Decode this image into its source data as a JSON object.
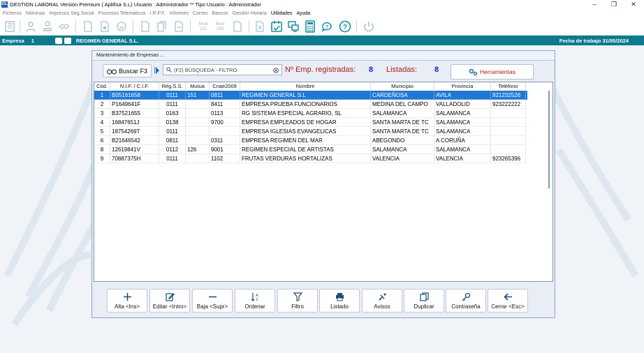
{
  "window": {
    "title": "GESTION LABORAL Versión Premium ( Aplifisa S.L)   Usuario : Administrador  **  Tipo Usuario : Administrador",
    "app_icon_text": "GL"
  },
  "menu": [
    "Ficheros",
    "Nóminas",
    "Impresos Seg.Social",
    "Procesos Telemáticos",
    "I.R.P.F.",
    "Informes",
    "Correo",
    "Bancos",
    "Gestión Horaria",
    "Utilidades",
    "Ayuda"
  ],
  "toolbar": {
    "mod111": "Mod\n111",
    "mod190": "Mod\n190"
  },
  "empresa_bar": {
    "label": "Empresa",
    "number": "1",
    "name": "REGIMEN GENERAL  S.L.",
    "fecha": "Fecha de trabajo  31/05/2024"
  },
  "dialog": {
    "title": "Mantenimiento de Empresas ...",
    "search_button": "Buscar F3",
    "search_placeholder": "(F2) BÚSQUEDA - FILTRO",
    "registradas_label": "Nº Emp. registradas:",
    "registradas_value": "8",
    "listadas_label": "Listadas:",
    "listadas_value": "8",
    "tools_button": "Herramientas"
  },
  "grid": {
    "columns": [
      "Cód.",
      "N.I.F. / C.I.F.",
      "Rég.S.S.",
      "Mutua",
      "Cnae2009",
      "Nombre",
      "Municipio",
      "Provincia",
      "Teléfono"
    ],
    "rows": [
      [
        "1",
        "B05161658",
        "0111",
        "151",
        "0811",
        "REGIMEN GENERAL S.L",
        "CARDEÑOSA",
        "AVILA",
        "921232526"
      ],
      [
        "2",
        "P1649641F",
        "0111",
        "",
        "8411",
        "EMPRESA  PRUEBA FUNCIONARIOS",
        "MEDINA DEL CAMPO",
        "VALLADOLID",
        "923222222"
      ],
      [
        "3",
        "B37521655",
        "0163",
        "",
        "0113",
        "RG SISTEMA ESPECIAL AGRARIO, SL",
        "SALAMANCA",
        "SALAMANCA",
        ""
      ],
      [
        "4",
        "16847651J",
        "0138",
        "",
        "9700",
        "EMPRESA EMPLEADOS DE HOGAR",
        "SANTA MARTA DE TC",
        "SALAMANCA",
        ""
      ],
      [
        "5",
        "18754269T",
        "0111",
        "",
        "",
        "EMPRESA IGLESIAS EVANGELICAS",
        "SANTA MARTA DE TC",
        "SALAMANCA",
        ""
      ],
      [
        "6",
        "B21646542",
        "0811",
        "",
        "0311",
        "EMPRESA REGIMEN DEL MAR",
        "ABEGONDO",
        "A CORUÑA",
        ""
      ],
      [
        "8",
        "12619841V",
        "0112",
        "126",
        "9001",
        "REGIMEN ESPECIAL DE ARTISTAS",
        "SALAMANCA",
        "SALAMANCA",
        ""
      ],
      [
        "9",
        "70887375H",
        "0111",
        "",
        "1102",
        "FRUTAS VERDURAS HORTALIZAS",
        "VALENCIA",
        "VALENCIA",
        "923265396"
      ]
    ]
  },
  "bottom_buttons": {
    "alta": "Alta <Ins>",
    "editar": "Editar <Intro>",
    "baja": "Baja <Supr>",
    "ordenar": "Ordenar",
    "filtro": "Filtro",
    "listado": "Listado",
    "avisos": "Avisos",
    "duplicar": "Duplicar",
    "contrasena": "Contraseña",
    "cerrar": "Cerrar <Esc>"
  },
  "colors": {
    "empresa_bar": "#0a7a8c",
    "selected_row": "#1f78d4",
    "stat_label": "#b01a1a",
    "stat_value": "#1520c8",
    "toolbar_icon": "#1a8ea0"
  }
}
